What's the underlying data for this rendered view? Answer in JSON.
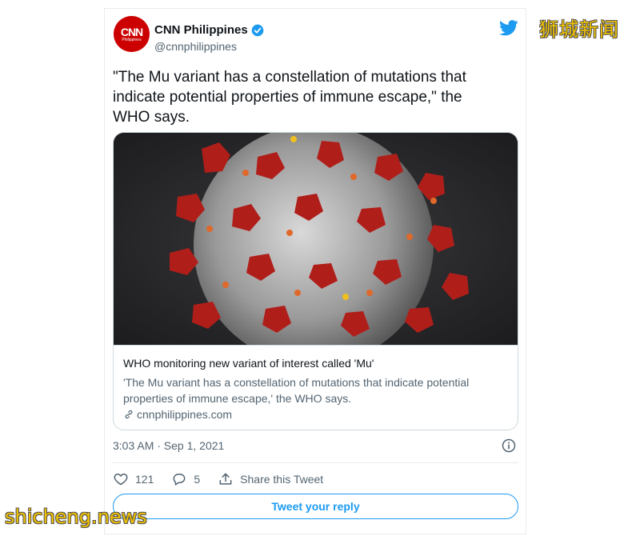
{
  "tweet": {
    "author_name": "CNN Philippines",
    "author_handle": "@cnnphilippines",
    "avatar_text": "CNN",
    "avatar_subtext": "Philippines",
    "text": "\"The Mu variant has a constellation of mutations that indicate potential properties of immune escape,\" the WHO says.",
    "timestamp": "3:03 AM · Sep 1, 2021"
  },
  "link_card": {
    "title": "WHO monitoring new variant of interest called 'Mu'",
    "description": "'The Mu variant has a constellation of mutations that indicate potential properties of immune escape,' the WHO says.",
    "domain": "cnnphilippines.com"
  },
  "actions": {
    "likes": "121",
    "replies": "5",
    "share_label": "Share this Tweet"
  },
  "reply_button_label": "Tweet your reply",
  "watermarks": {
    "chinese": "狮城新闻",
    "english": "shicheng.news"
  },
  "colors": {
    "accent": "#1d9bf0",
    "brand_red": "#cc0000",
    "watermark": "#f2c200"
  },
  "icons": {
    "verified": "verified-badge-icon",
    "bird": "twitter-bird-icon",
    "link": "link-icon",
    "info": "info-icon",
    "like": "heart-icon",
    "reply": "comment-icon",
    "share": "share-icon"
  }
}
